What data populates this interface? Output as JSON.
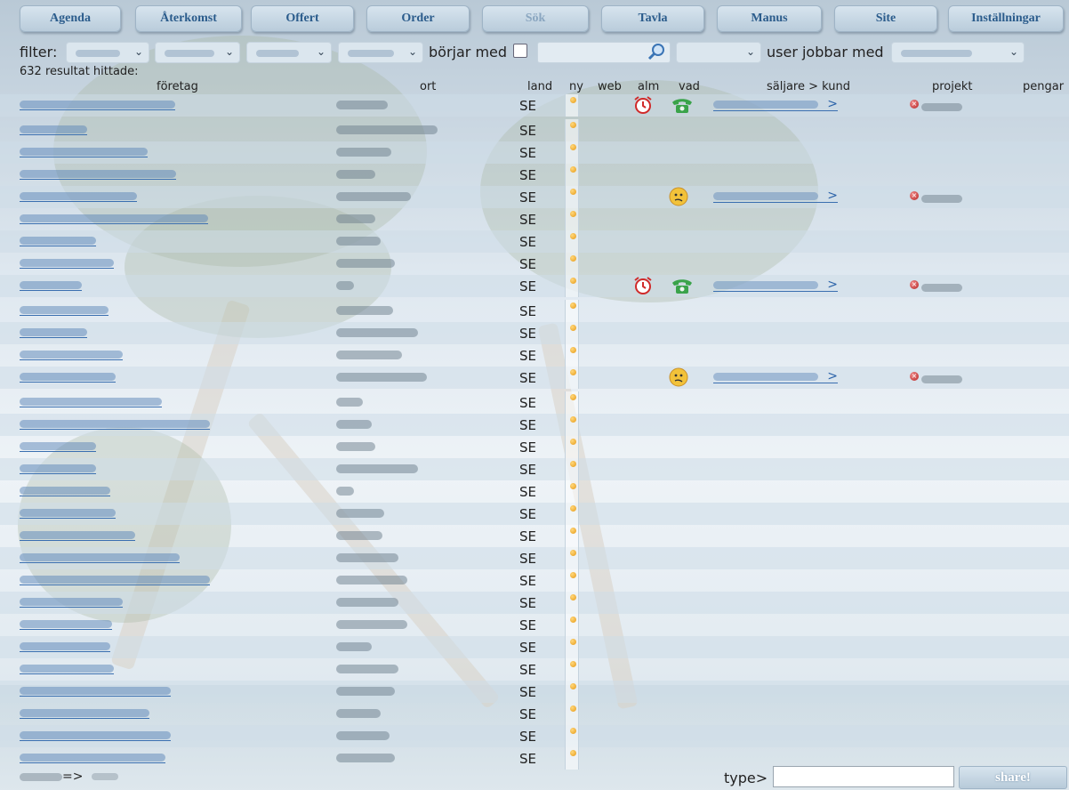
{
  "nav": {
    "items": [
      {
        "label": "Agenda"
      },
      {
        "label": "Återkomst"
      },
      {
        "label": "Offert"
      },
      {
        "label": "Order"
      },
      {
        "label": "Sök"
      },
      {
        "label": "Tavla"
      },
      {
        "label": "Manus"
      },
      {
        "label": "Site"
      },
      {
        "label": "Inställningar"
      }
    ],
    "active": "Sök"
  },
  "filter": {
    "label": "filter:",
    "begins_with_label": "börjar med",
    "begins_with_checked": false,
    "search_value": "",
    "user_label": "user jobbar med"
  },
  "results": {
    "count_text": "632 resultat hittade:"
  },
  "table": {
    "headers": {
      "company": "företag",
      "city": "ort",
      "country": "land",
      "new": "ny",
      "web": "web",
      "alarm": "alm",
      "what": "vad",
      "seller": "säljare > kund",
      "project": "projekt",
      "money": "pengar"
    },
    "rows": [
      {
        "country": "SE",
        "alarm": true,
        "what": "phone",
        "seller": ">",
        "project": true
      },
      {
        "country": "SE"
      },
      {
        "country": "SE"
      },
      {
        "country": "SE"
      },
      {
        "country": "SE",
        "what": "face",
        "seller": ">",
        "project": true
      },
      {
        "country": "SE"
      },
      {
        "country": "SE"
      },
      {
        "country": "SE"
      },
      {
        "country": "SE",
        "alarm": true,
        "what": "phone",
        "seller": ">",
        "project": true
      },
      {
        "country": "SE"
      },
      {
        "country": "SE"
      },
      {
        "country": "SE"
      },
      {
        "country": "SE",
        "what": "face",
        "seller": ">",
        "project": true
      },
      {
        "country": "SE"
      },
      {
        "country": "SE"
      },
      {
        "country": "SE"
      },
      {
        "country": "SE"
      },
      {
        "country": "SE"
      },
      {
        "country": "SE"
      },
      {
        "country": "SE"
      },
      {
        "country": "SE"
      },
      {
        "country": "SE"
      },
      {
        "country": "SE"
      },
      {
        "country": "SE"
      },
      {
        "country": "SE"
      },
      {
        "country": "SE"
      },
      {
        "country": "SE"
      },
      {
        "country": "SE"
      },
      {
        "country": "SE"
      },
      {
        "country": "SE"
      }
    ]
  },
  "footer": {
    "nav_text": "=>",
    "type_label": "type>",
    "type_value": "",
    "share_label": "share!"
  },
  "colors": {
    "nav_text": "#2b5c8c",
    "link": "#2a62a8",
    "alarm": "#d02a2a",
    "phone": "#3aa34a",
    "remove": "#b52424"
  }
}
